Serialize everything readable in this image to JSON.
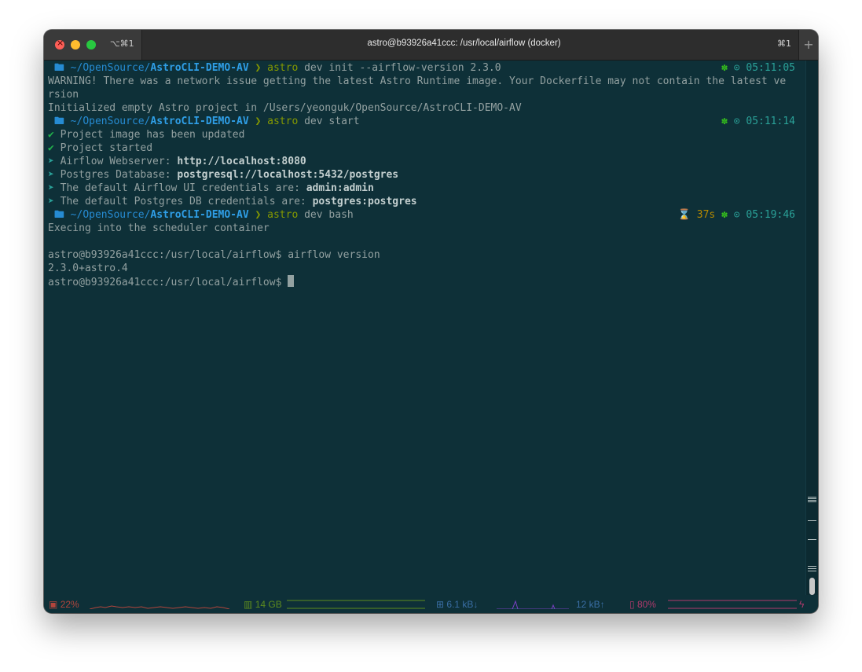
{
  "window": {
    "title": "astro@b93926a41ccc: /usr/local/airflow (docker)",
    "shortcut_left": "⌥⌘1",
    "shortcut_right": "⌘1",
    "new_tab": "+"
  },
  "prompt": {
    "apple": "",
    "folder_icon": "🖿",
    "path_prefix": "~/OpenSource/",
    "path_dir": "AstroCLI-DEMO-AV",
    "arrow": "❯"
  },
  "terminal": {
    "cmd1_tool": "astro",
    "cmd1_rest": " dev init --airflow-version 2.3.0",
    "time1": "05:11:05",
    "warn1": "WARNING! There was a network issue getting the latest Astro Runtime image. Your Dockerfile may not contain the latest ve",
    "warn2": "rsion",
    "init_msg": "Initialized empty Astro project in /Users/yeonguk/OpenSource/AstroCLI-DEMO-AV",
    "cmd2_tool": "astro",
    "cmd2_rest": " dev start",
    "time2": "05:11:14",
    "check": "✔",
    "ok1": "Project image has been updated",
    "ok2": "Project started",
    "chev": "➤",
    "info1_label": "Airflow Webserver: ",
    "info1_value": "http://localhost:8080",
    "info2_label": "Postgres Database: ",
    "info2_value": "postgresql://localhost:5432/postgres",
    "info3_label": "The default Airflow UI credentials are: ",
    "info3_value": "admin:admin",
    "info4_label": "The default Postgres DB credentials are: ",
    "info4_value": "postgres:postgres",
    "cmd3_tool": "astro",
    "cmd3_rest": " dev bash",
    "duration": "37s",
    "time3": "05:19:46",
    "exec_msg": "Execing into the scheduler container",
    "shell_line1": "astro@b93926a41ccc:/usr/local/airflow$ airflow version",
    "version_out": "2.3.0+astro.4",
    "shell_prompt": "astro@b93926a41ccc:/usr/local/airflow$ ",
    "gear": "✽",
    "clock": "⊙",
    "hourglass": "⌛"
  },
  "status": {
    "cpu": "22%",
    "ram": "14 GB",
    "net_down": "6.1 kB↓",
    "net_up": "12 kB↑",
    "battery": "80%",
    "colors": {
      "cpu": "#b2453c",
      "ram": "#5e8c1e",
      "net": "#3a6ea5",
      "battery": "#b03a6c"
    }
  }
}
